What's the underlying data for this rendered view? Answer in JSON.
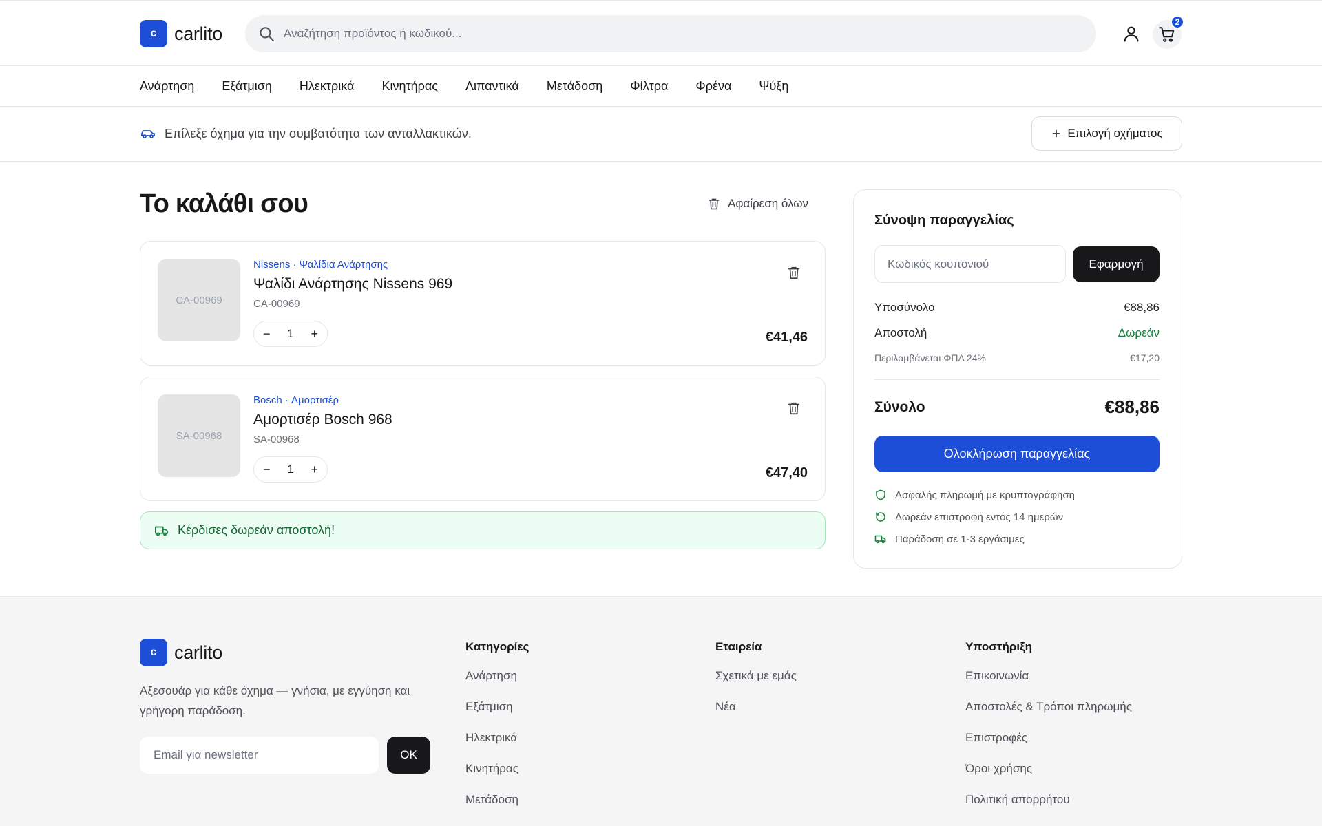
{
  "brand": {
    "logo_letter": "c",
    "name": "carlito",
    "accent": "#1d4ed8"
  },
  "header": {
    "search_placeholder": "Αναζήτηση προϊόντος ή κωδικού...",
    "cart_count": "2"
  },
  "nav": [
    "Ανάρτηση",
    "Εξάτμιση",
    "Ηλεκτρικά",
    "Κινητήρας",
    "Λιπαντικά",
    "Μετάδοση",
    "Φίλτρα",
    "Φρένα",
    "Ψύξη"
  ],
  "vehicle_bar": {
    "text": "Επίλεξε όχημα για την συμβατότητα των ανταλλακτικών.",
    "button_label": "Επιλογή οχήματος"
  },
  "cart": {
    "title": "Το καλάθι σου",
    "remove_all_label": "Αφαίρεση όλων",
    "items": [
      {
        "thumb_label": "CA-00969",
        "category": "Nissens · Ψαλίδια Ανάρτησης",
        "name": "Ψαλίδι Ανάρτησης Nissens 969",
        "sku": "CA-00969",
        "qty": "1",
        "price": "€41,46"
      },
      {
        "thumb_label": "SA-00968",
        "category": "Bosch · Αμορτισέρ",
        "name": "Αμορτισέρ Bosch 968",
        "sku": "SA-00968",
        "qty": "1",
        "price": "€47,40"
      }
    ],
    "free_shipping_message": "Κέρδισες δωρεάν αποστολή!"
  },
  "summary": {
    "title": "Σύνοψη παραγγελίας",
    "coupon_placeholder": "Κωδικός κουπονιού",
    "apply_label": "Εφαρμογή",
    "subtotal_label": "Υποσύνολο",
    "subtotal_value": "€88,86",
    "shipping_label": "Αποστολή",
    "shipping_value": "Δωρεάν",
    "vat_label": "Περιλαμβάνεται ΦΠΑ 24%",
    "vat_value": "€17,20",
    "total_label": "Σύνολο",
    "total_value": "€88,86",
    "checkout_label": "Ολοκλήρωση παραγγελίας",
    "perks": [
      "Ασφαλής πληρωμή με κρυπτογράφηση",
      "Δωρεάν επιστροφή εντός 14 ημερών",
      "Παράδοση σε 1-3 εργάσιμες"
    ]
  },
  "footer": {
    "description": "Αξεσουάρ για κάθε όχημα — γνήσια, με εγγύηση και γρήγορη παράδοση.",
    "newsletter_placeholder": "Email για newsletter",
    "newsletter_button": "OK",
    "columns": [
      {
        "title": "Κατηγορίες",
        "links": [
          "Ανάρτηση",
          "Εξάτμιση",
          "Ηλεκτρικά",
          "Κινητήρας",
          "Μετάδοση"
        ]
      },
      {
        "title": "Εταιρεία",
        "links": [
          "Σχετικά με εμάς",
          "Νέα"
        ]
      },
      {
        "title": "Υποστήριξη",
        "links": [
          "Επικοινωνία",
          "Αποστολές & Τρόποι πληρωμής",
          "Επιστροφές",
          "Όροι χρήσης",
          "Πολιτική απορρήτου"
        ]
      }
    ]
  }
}
